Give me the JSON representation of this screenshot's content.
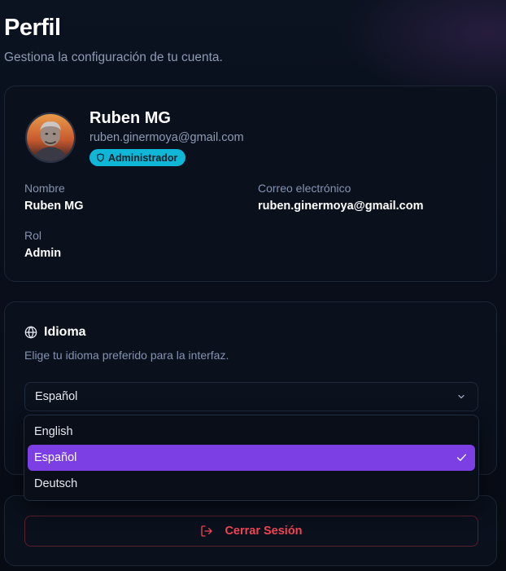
{
  "header": {
    "title": "Perfil",
    "subtitle": "Gestiona la configuración de tu cuenta."
  },
  "profile": {
    "name": "Ruben MG",
    "email": "ruben.ginermoya@gmail.com",
    "role_badge": "Administrador",
    "fields": {
      "name_label": "Nombre",
      "name_value": "Ruben MG",
      "email_label": "Correo electrónico",
      "email_value": "ruben.ginermoya@gmail.com",
      "role_label": "Rol",
      "role_value": "Admin"
    }
  },
  "language": {
    "title": "Idioma",
    "description": "Elige tu idioma preferido para la interfaz.",
    "selected": "Español",
    "options": [
      "English",
      "Español",
      "Deutsch"
    ]
  },
  "logout": {
    "label": "Cerrar Sesión"
  },
  "colors": {
    "accent": "#7b3fe4",
    "badge": "#10b6d6",
    "danger": "#f04454"
  }
}
